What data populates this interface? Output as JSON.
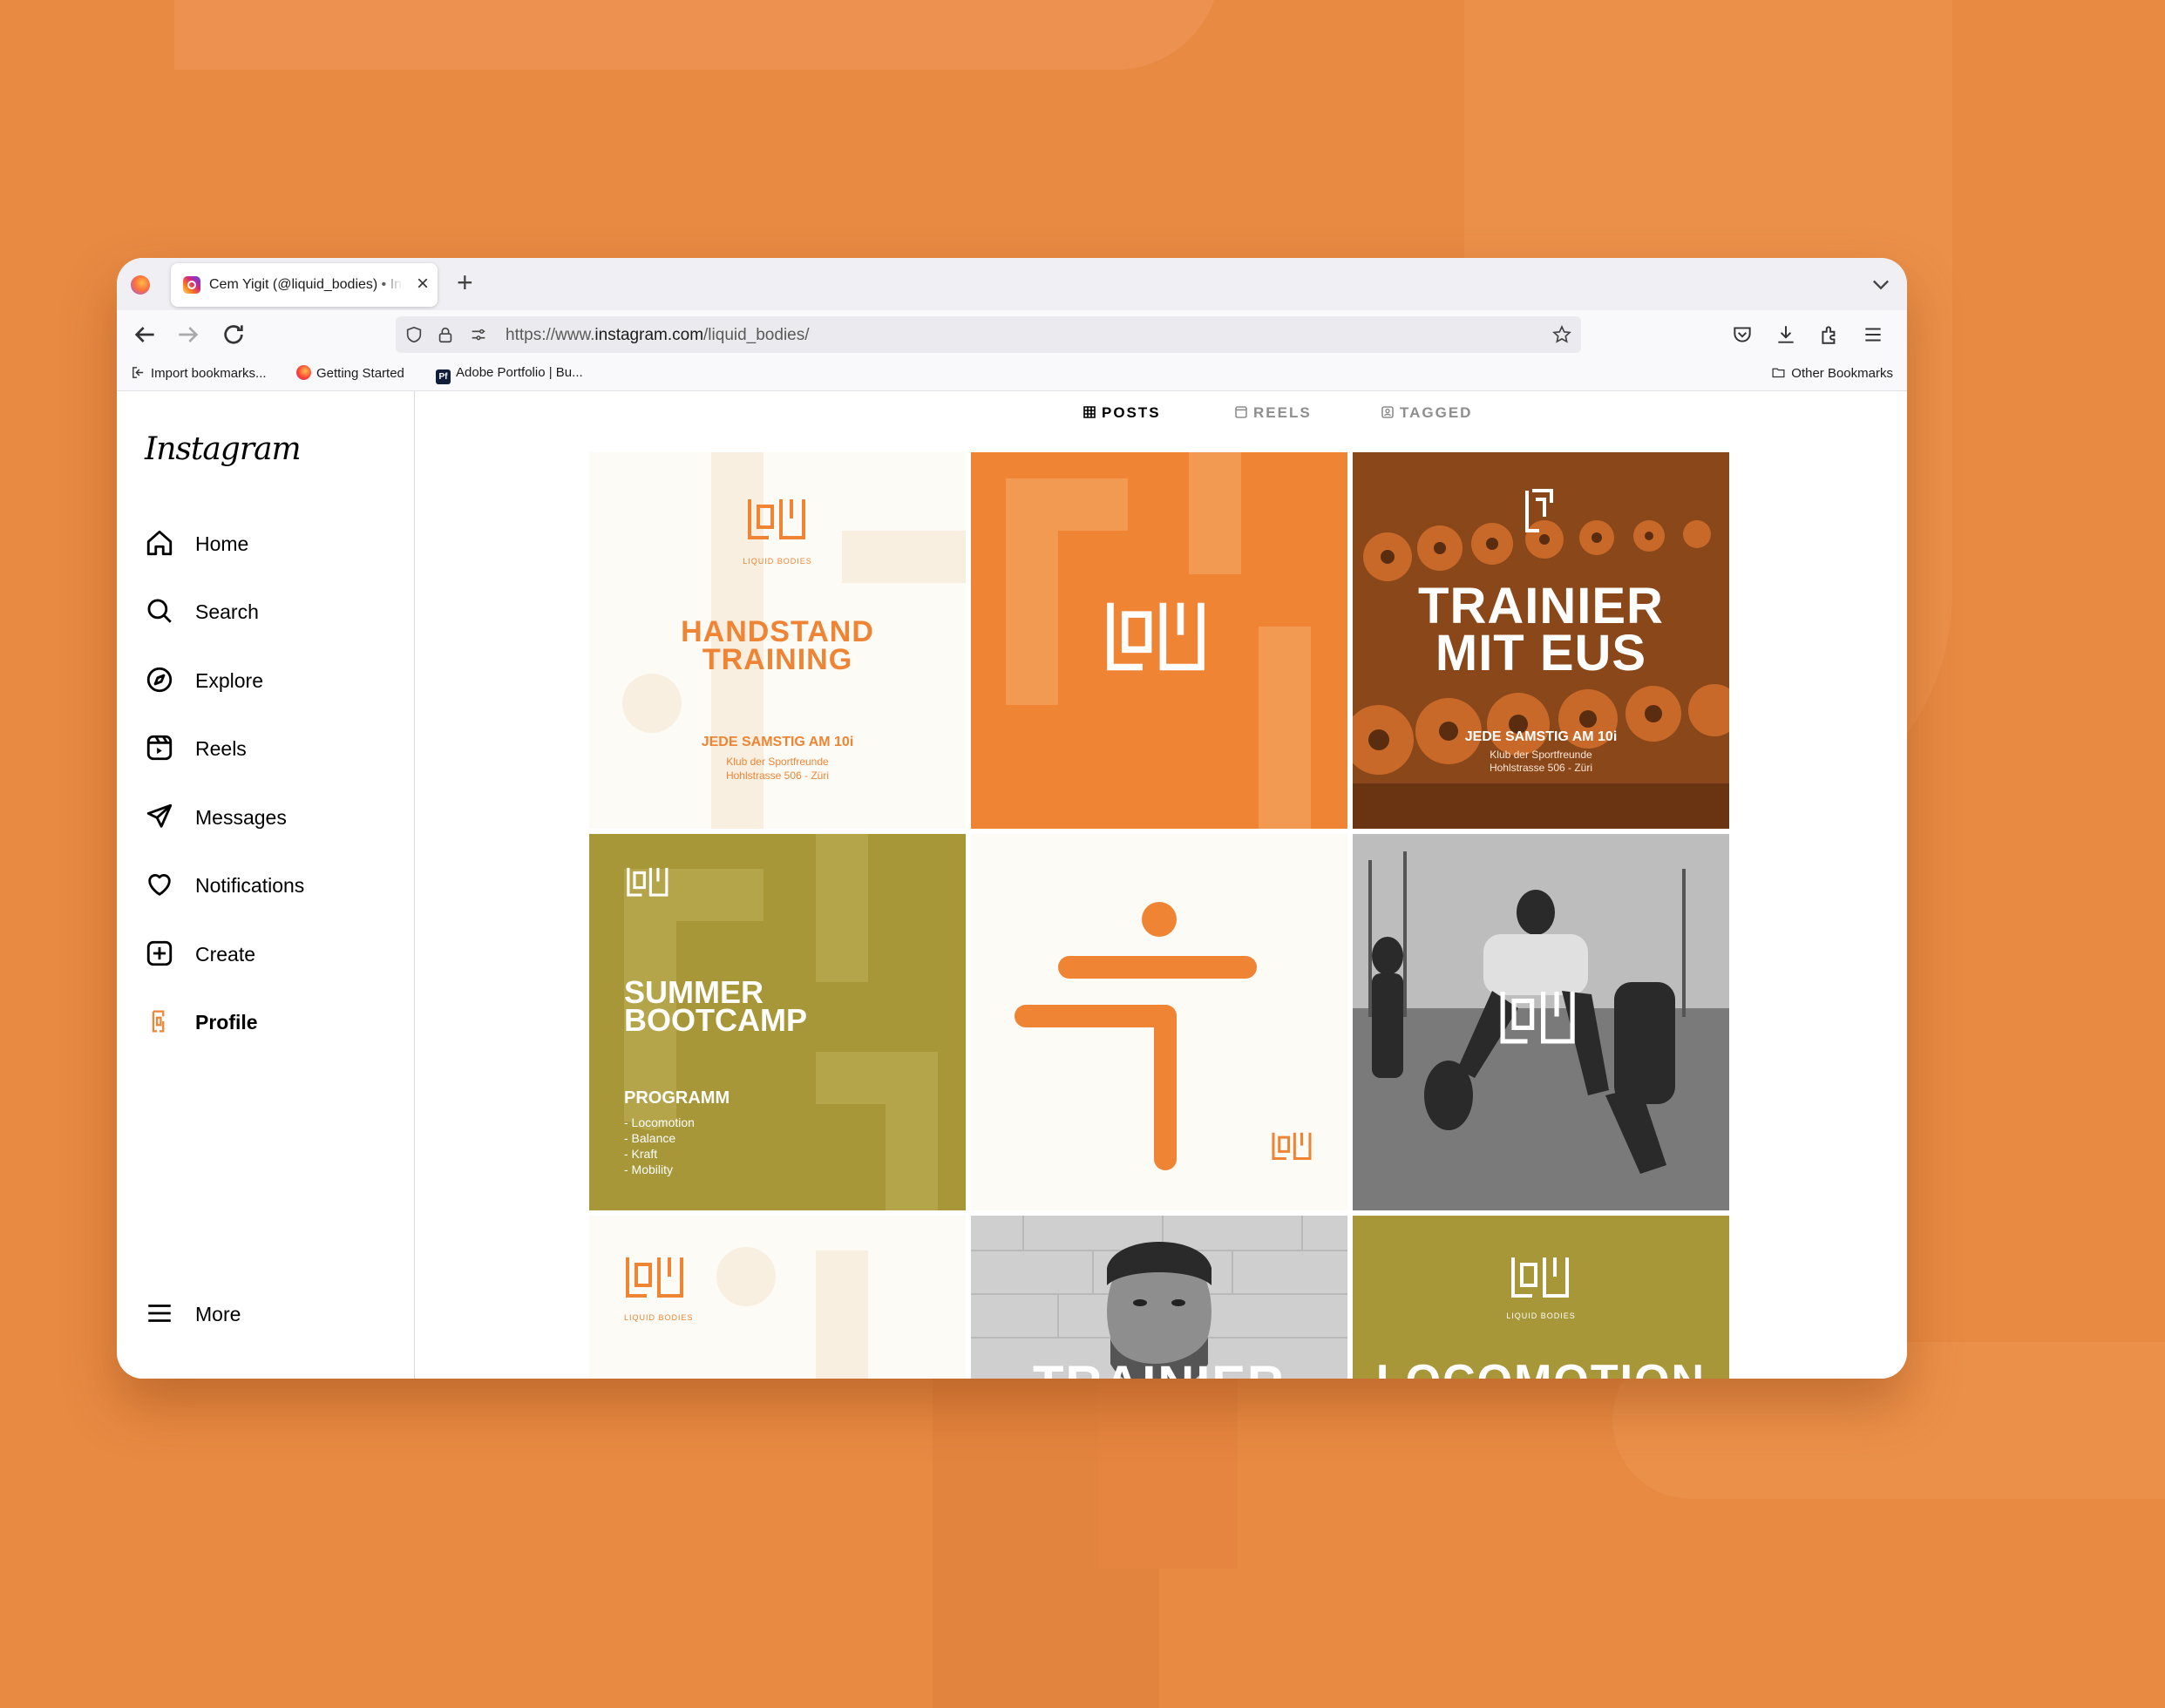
{
  "browser": {
    "tab_title": "Cem Yigit (@liquid_bodies) • Instagram",
    "url_prefix": "https://www.",
    "url_domain": "instagram.com",
    "url_path": "/liquid_bodies/",
    "bookmarks": [
      "Import bookmarks...",
      "Getting Started",
      "Adobe Portfolio | Bu..."
    ],
    "other_bookmarks": "Other Bookmarks"
  },
  "sidebar": {
    "logo": "Instagram",
    "items": [
      {
        "label": "Home",
        "icon": "home-icon"
      },
      {
        "label": "Search",
        "icon": "search-icon"
      },
      {
        "label": "Explore",
        "icon": "compass-icon"
      },
      {
        "label": "Reels",
        "icon": "reels-icon"
      },
      {
        "label": "Messages",
        "icon": "paper-plane-icon"
      },
      {
        "label": "Notifications",
        "icon": "heart-icon"
      },
      {
        "label": "Create",
        "icon": "plus-square-icon"
      },
      {
        "label": "Profile",
        "icon": "profile-avatar-icon"
      }
    ],
    "more": "More"
  },
  "profile_tabs": [
    {
      "label": "POSTS",
      "active": true
    },
    {
      "label": "REELS",
      "active": false
    },
    {
      "label": "TAGGED",
      "active": false
    }
  ],
  "posts": {
    "p1": {
      "brand": "LIQUID BODIES",
      "title_line1": "HANDSTAND",
      "title_line2": "TRAINING",
      "when": "JEDE SAMSTIG AM 10i",
      "venue": "Klub der Sportfreunde",
      "address": "Hohlstrasse 506 - Züri"
    },
    "p3": {
      "title_line1": "TRAINIER",
      "title_line2": "MIT EUS",
      "when": "JEDE SAMSTIG AM 10i",
      "venue": "Klub der Sportfreunde",
      "address": "Hohlstrasse 506 - Züri"
    },
    "p4": {
      "title_line1": "SUMMER",
      "title_line2": "BOOTCAMP",
      "program_title": "PROGRAMM",
      "program": [
        "- Locomotion",
        "- Balance",
        "- Kraft",
        "- Mobility"
      ]
    },
    "p7": {
      "brand": "LIQUID BODIES"
    },
    "p8": {
      "title": "TRAINIER"
    },
    "p9": {
      "brand": "LIQUID BODIES",
      "title": "LOCOMOTION"
    }
  },
  "colors": {
    "orange": "#ef8434",
    "cream": "#fdfbf5",
    "olive": "#a89738",
    "background": "#e88a42"
  }
}
